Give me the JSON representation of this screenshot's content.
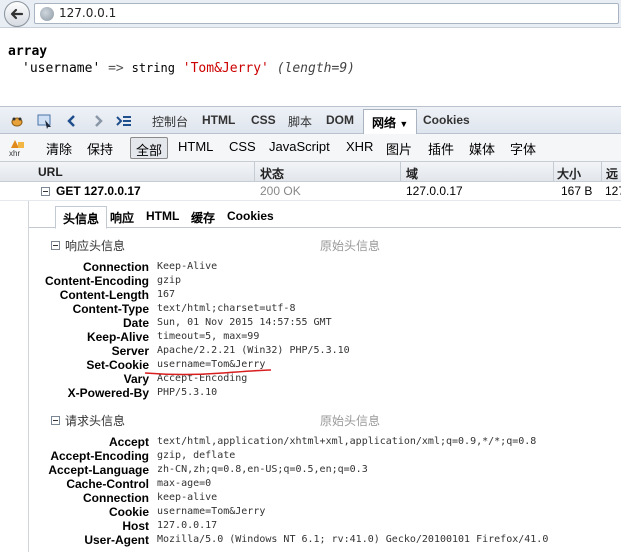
{
  "browser": {
    "url": "127.0.0.1"
  },
  "page": {
    "line1": "array",
    "key": "'username'",
    "arrow": "=>",
    "type": "string",
    "value": "'Tom&Jerry'",
    "length": "(length=9)"
  },
  "firebug": {
    "tabs": {
      "console": "控制台",
      "html": "HTML",
      "css": "CSS",
      "script": "脚本",
      "dom": "DOM",
      "net": "网络",
      "cookies": "Cookies"
    },
    "filters": {
      "clear": "清除",
      "persist": "保持",
      "all": "全部",
      "html": "HTML",
      "css": "CSS",
      "js": "JavaScript",
      "xhr": "XHR",
      "images": "图片",
      "plugins": "插件",
      "media": "媒体",
      "fonts": "字体",
      "xhr_icon_label": "xhr"
    },
    "columns": {
      "url": "URL",
      "status": "状态",
      "domain": "域",
      "size": "大小",
      "remote": "远程"
    },
    "request": {
      "method_url": "GET 127.0.0.17",
      "status": "200 OK",
      "domain": "127.0.0.17",
      "size": "167 B",
      "remote": "127"
    },
    "subtabs": {
      "headers": "头信息",
      "response": "响应",
      "html": "HTML",
      "cache": "缓存",
      "cookies": "Cookies"
    },
    "response_headers": {
      "title": "响应头信息",
      "raw": "原始头信息",
      "rows": [
        {
          "name": "Connection",
          "value": "Keep-Alive"
        },
        {
          "name": "Content-Encoding",
          "value": "gzip"
        },
        {
          "name": "Content-Length",
          "value": "167"
        },
        {
          "name": "Content-Type",
          "value": "text/html;charset=utf-8"
        },
        {
          "name": "Date",
          "value": "Sun, 01 Nov 2015 14:57:55 GMT"
        },
        {
          "name": "Keep-Alive",
          "value": "timeout=5, max=99"
        },
        {
          "name": "Server",
          "value": "Apache/2.2.21 (Win32) PHP/5.3.10"
        },
        {
          "name": "Set-Cookie",
          "value": "username=Tom&Jerry"
        },
        {
          "name": "Vary",
          "value": "Accept-Encoding"
        },
        {
          "name": "X-Powered-By",
          "value": "PHP/5.3.10"
        }
      ]
    },
    "request_headers": {
      "title": "请求头信息",
      "raw": "原始头信息",
      "rows": [
        {
          "name": "Accept",
          "value": "text/html,application/xhtml+xml,application/xml;q=0.9,*/*;q=0.8"
        },
        {
          "name": "Accept-Encoding",
          "value": "gzip, deflate"
        },
        {
          "name": "Accept-Language",
          "value": "zh-CN,zh;q=0.8,en-US;q=0.5,en;q=0.3"
        },
        {
          "name": "Cache-Control",
          "value": "max-age=0"
        },
        {
          "name": "Connection",
          "value": "keep-alive"
        },
        {
          "name": "Cookie",
          "value": "username=Tom&Jerry"
        },
        {
          "name": "Host",
          "value": "127.0.0.17"
        },
        {
          "name": "User-Agent",
          "value": "Mozilla/5.0 (Windows NT 6.1; rv:41.0) Gecko/20100101 Firefox/41.0"
        }
      ]
    }
  },
  "colors": {
    "string_value": "#cc0000",
    "annotation": "#d81e1e"
  }
}
